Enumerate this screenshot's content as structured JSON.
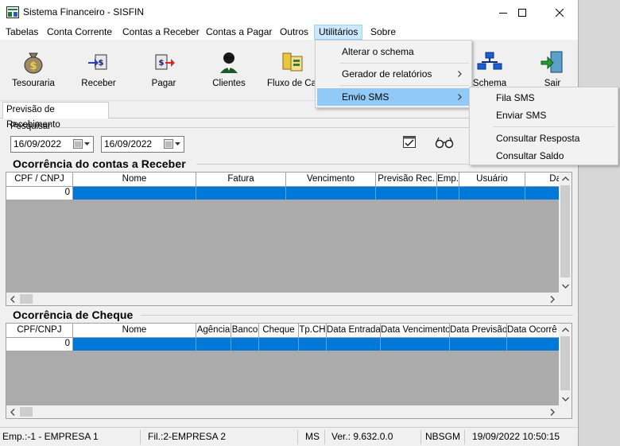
{
  "window": {
    "title": "Sistema Financeiro - SISFIN"
  },
  "menubar": {
    "items": [
      "Tabelas",
      "Conta Corrente",
      "Contas a Receber",
      "Contas a Pagar",
      "Outros",
      "Utilitários",
      "Sobre"
    ]
  },
  "toolbar": {
    "buttons": [
      {
        "label": "Tesouraria",
        "icon": "money-bag-icon"
      },
      {
        "label": "Receber",
        "icon": "receive-money-icon"
      },
      {
        "label": "Pagar",
        "icon": "pay-money-icon"
      },
      {
        "label": "Clientes",
        "icon": "client-person-icon"
      },
      {
        "label": "Fluxo de Cai",
        "icon": "cash-flow-icon"
      },
      {
        "label": "Schema",
        "icon": "schema-tree-icon"
      },
      {
        "label": "Sair",
        "icon": "exit-door-icon"
      }
    ]
  },
  "tab": {
    "label": "Previsão de Recebimento"
  },
  "search": {
    "label": "Pesquisar",
    "date_from": "16/09/2022",
    "date_to": "16/09/2022"
  },
  "receivables": {
    "title": "Ocorrência do contas a Receber",
    "columns": [
      "CPF / CNPJ",
      "Nome",
      "Fatura",
      "Vencimento",
      "Previsão Rec.",
      "Emp.",
      "Usuário",
      "Da"
    ],
    "row_value": "0"
  },
  "cheques": {
    "title": "Ocorrência de Cheque",
    "columns": [
      "CPF/CNPJ",
      "Nome",
      "Agência",
      "Banco",
      "Cheque",
      "Tp.CH",
      "Data Entrada",
      "Data Vencimento",
      "Data Previsão",
      "Data Ocorrê"
    ],
    "row_value": "0"
  },
  "utilitarios_menu": {
    "items": [
      "Alterar o schema",
      "Gerador de relatórios",
      "Envio SMS"
    ]
  },
  "sms_menu": {
    "items": [
      "Fila SMS",
      "Enviar SMS",
      "Consultar Resposta",
      "Consultar Saldo"
    ]
  },
  "statusbar": {
    "empresa": "Emp.:-1 - EMPRESA 1",
    "filial": "Fil.:2-EMPRESA 2",
    "ms": "MS",
    "versao": "Ver.: 9.632.0.0",
    "user": "NBSGM",
    "datetime": "19/09/2022 10:50:15"
  },
  "colors": {
    "selection": "#0078d7",
    "menu_highlight": "#91c9f7",
    "window_bg": "#f0f0f0"
  }
}
